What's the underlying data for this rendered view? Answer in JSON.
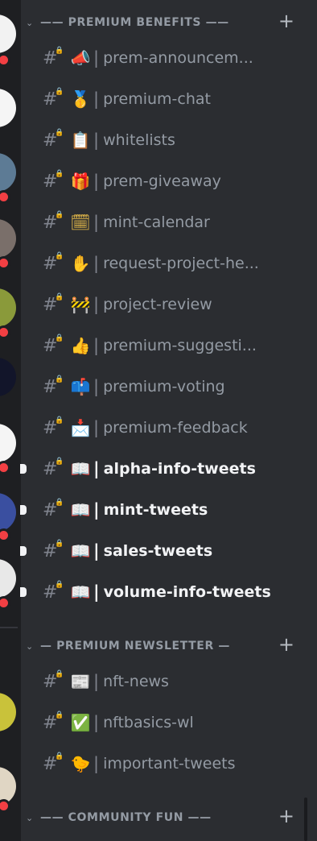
{
  "categories": [
    {
      "name": "—— PREMIUM BENEFITS ——",
      "chevron": "chevron-down-icon",
      "add": "+"
    },
    {
      "name": "— PREMIUM NEWSLETTER —",
      "chevron": "chevron-down-icon",
      "add": "+"
    },
    {
      "name": "—— COMMUNITY FUN ——",
      "chevron": "chevron-down-icon",
      "add": "+"
    }
  ],
  "channels": [
    {
      "emoji": "📣",
      "name": "prem-announcem...",
      "unread": false
    },
    {
      "emoji": "🥇",
      "name": "premium-chat",
      "unread": false
    },
    {
      "emoji": "📋",
      "name": "whitelists",
      "unread": false
    },
    {
      "emoji": "🎁",
      "name": "prem-giveaway",
      "unread": false
    },
    {
      "emoji": "🗓",
      "name": "mint-calendar",
      "unread": false
    },
    {
      "emoji": "✋",
      "name": "request-project-he...",
      "unread": false
    },
    {
      "emoji": "🚧",
      "name": "project-review",
      "unread": false
    },
    {
      "emoji": "👍",
      "name": "premium-suggesti...",
      "unread": false
    },
    {
      "emoji": "📫",
      "name": "premium-voting",
      "unread": false
    },
    {
      "emoji": "📩",
      "name": "premium-feedback",
      "unread": false
    },
    {
      "emoji": "📖",
      "name": "alpha-info-tweets",
      "unread": true
    },
    {
      "emoji": "📖",
      "name": "mint-tweets",
      "unread": true
    },
    {
      "emoji": "📖",
      "name": "sales-tweets",
      "unread": true
    },
    {
      "emoji": "📖",
      "name": "volume-info-tweets",
      "unread": true
    },
    {
      "emoji": "📰",
      "name": "nft-news",
      "unread": false
    },
    {
      "emoji": "✅",
      "name": "nftbasics-wl",
      "unread": false
    },
    {
      "emoji": "🐤",
      "name": "important-tweets",
      "unread": false
    }
  ],
  "symbols": {
    "hash": "#",
    "separator": "|"
  },
  "colors": {
    "background": "#2b2d31",
    "rail": "#1e1f22",
    "muted": "#949ba4",
    "unread": "#f2f3f5",
    "mention": "#f23f43"
  }
}
